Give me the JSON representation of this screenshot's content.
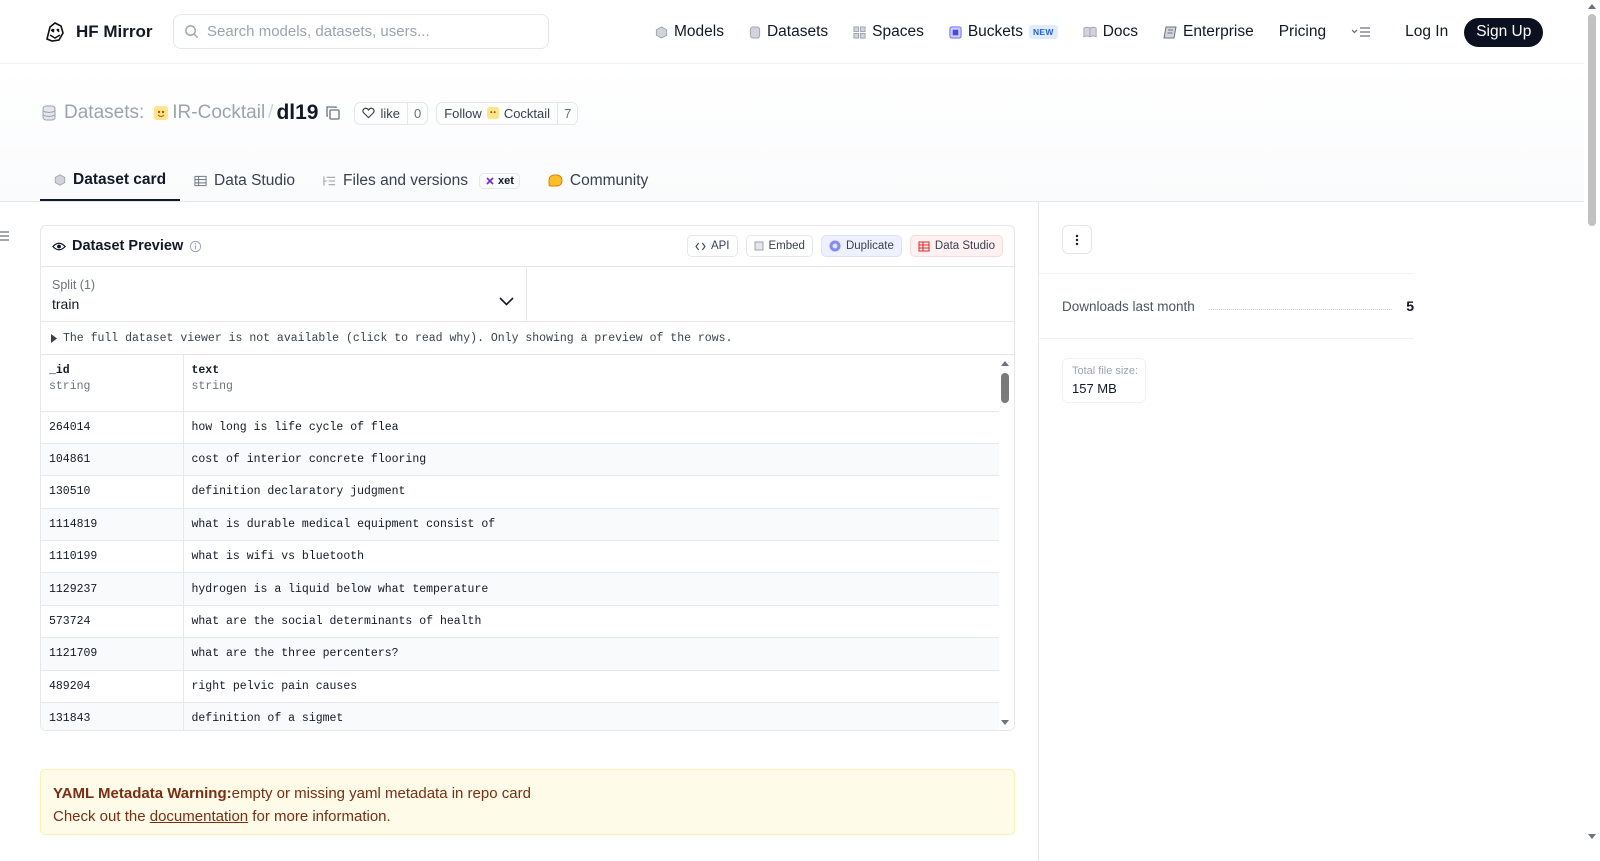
{
  "header": {
    "logo_text": "HF Mirror",
    "search_placeholder": "Search models, datasets, users...",
    "nav": [
      {
        "label": "Models",
        "icon": "cube-icon"
      },
      {
        "label": "Datasets",
        "icon": "database-icon"
      },
      {
        "label": "Spaces",
        "icon": "grid-icon"
      },
      {
        "label": "Buckets",
        "icon": "bucket-icon",
        "badge": "NEW"
      },
      {
        "label": "Docs",
        "icon": "book-icon"
      },
      {
        "label": "Enterprise",
        "icon": "enterprise-icon"
      },
      {
        "label": "Pricing"
      }
    ],
    "login": "Log In",
    "signup": "Sign Up"
  },
  "repo": {
    "type_label": "Datasets:",
    "org": "IR-Cocktail",
    "name": "dl19",
    "like_label": "like",
    "like_count": "0",
    "follow_label": "Follow",
    "follow_org": "Cocktail",
    "follow_count": "7"
  },
  "tabs": [
    {
      "label": "Dataset card",
      "active": true
    },
    {
      "label": "Data Studio"
    },
    {
      "label": "Files and versions",
      "badge": "xet"
    },
    {
      "label": "Community"
    }
  ],
  "preview": {
    "title": "Dataset Preview",
    "actions": [
      "API",
      "Embed",
      "Duplicate",
      "Data Studio"
    ],
    "split_label": "Split (1)",
    "split_value": "train",
    "notice": "The full dataset viewer is not available (click to read why). Only showing a preview of the rows.",
    "columns": [
      {
        "name": "_id",
        "type": "string"
      },
      {
        "name": "text",
        "type": "string"
      }
    ],
    "rows": [
      [
        "264014",
        "how long is life cycle of flea"
      ],
      [
        "104861",
        "cost of interior concrete flooring"
      ],
      [
        "130510",
        "definition declaratory judgment"
      ],
      [
        "1114819",
        "what is durable medical equipment consist of"
      ],
      [
        "1110199",
        "what is wifi vs bluetooth"
      ],
      [
        "1129237",
        "hydrogen is a liquid below what temperature"
      ],
      [
        "573724",
        "what are the social determinants of health"
      ],
      [
        "1121709",
        "what are the three percenters?"
      ],
      [
        "489204",
        "right pelvic pain causes"
      ],
      [
        "131843",
        "definition of a sigmet"
      ]
    ]
  },
  "warning": {
    "title": "YAML Metadata Warning:",
    "message": "empty or missing yaml metadata in repo card",
    "line2_prefix": "Check out the ",
    "link": "documentation",
    "line2_suffix": " for more information."
  },
  "sidebar": {
    "downloads_label": "Downloads last month",
    "downloads_value": "5",
    "size_label": "Total file size:",
    "size_value": "157 MB"
  }
}
